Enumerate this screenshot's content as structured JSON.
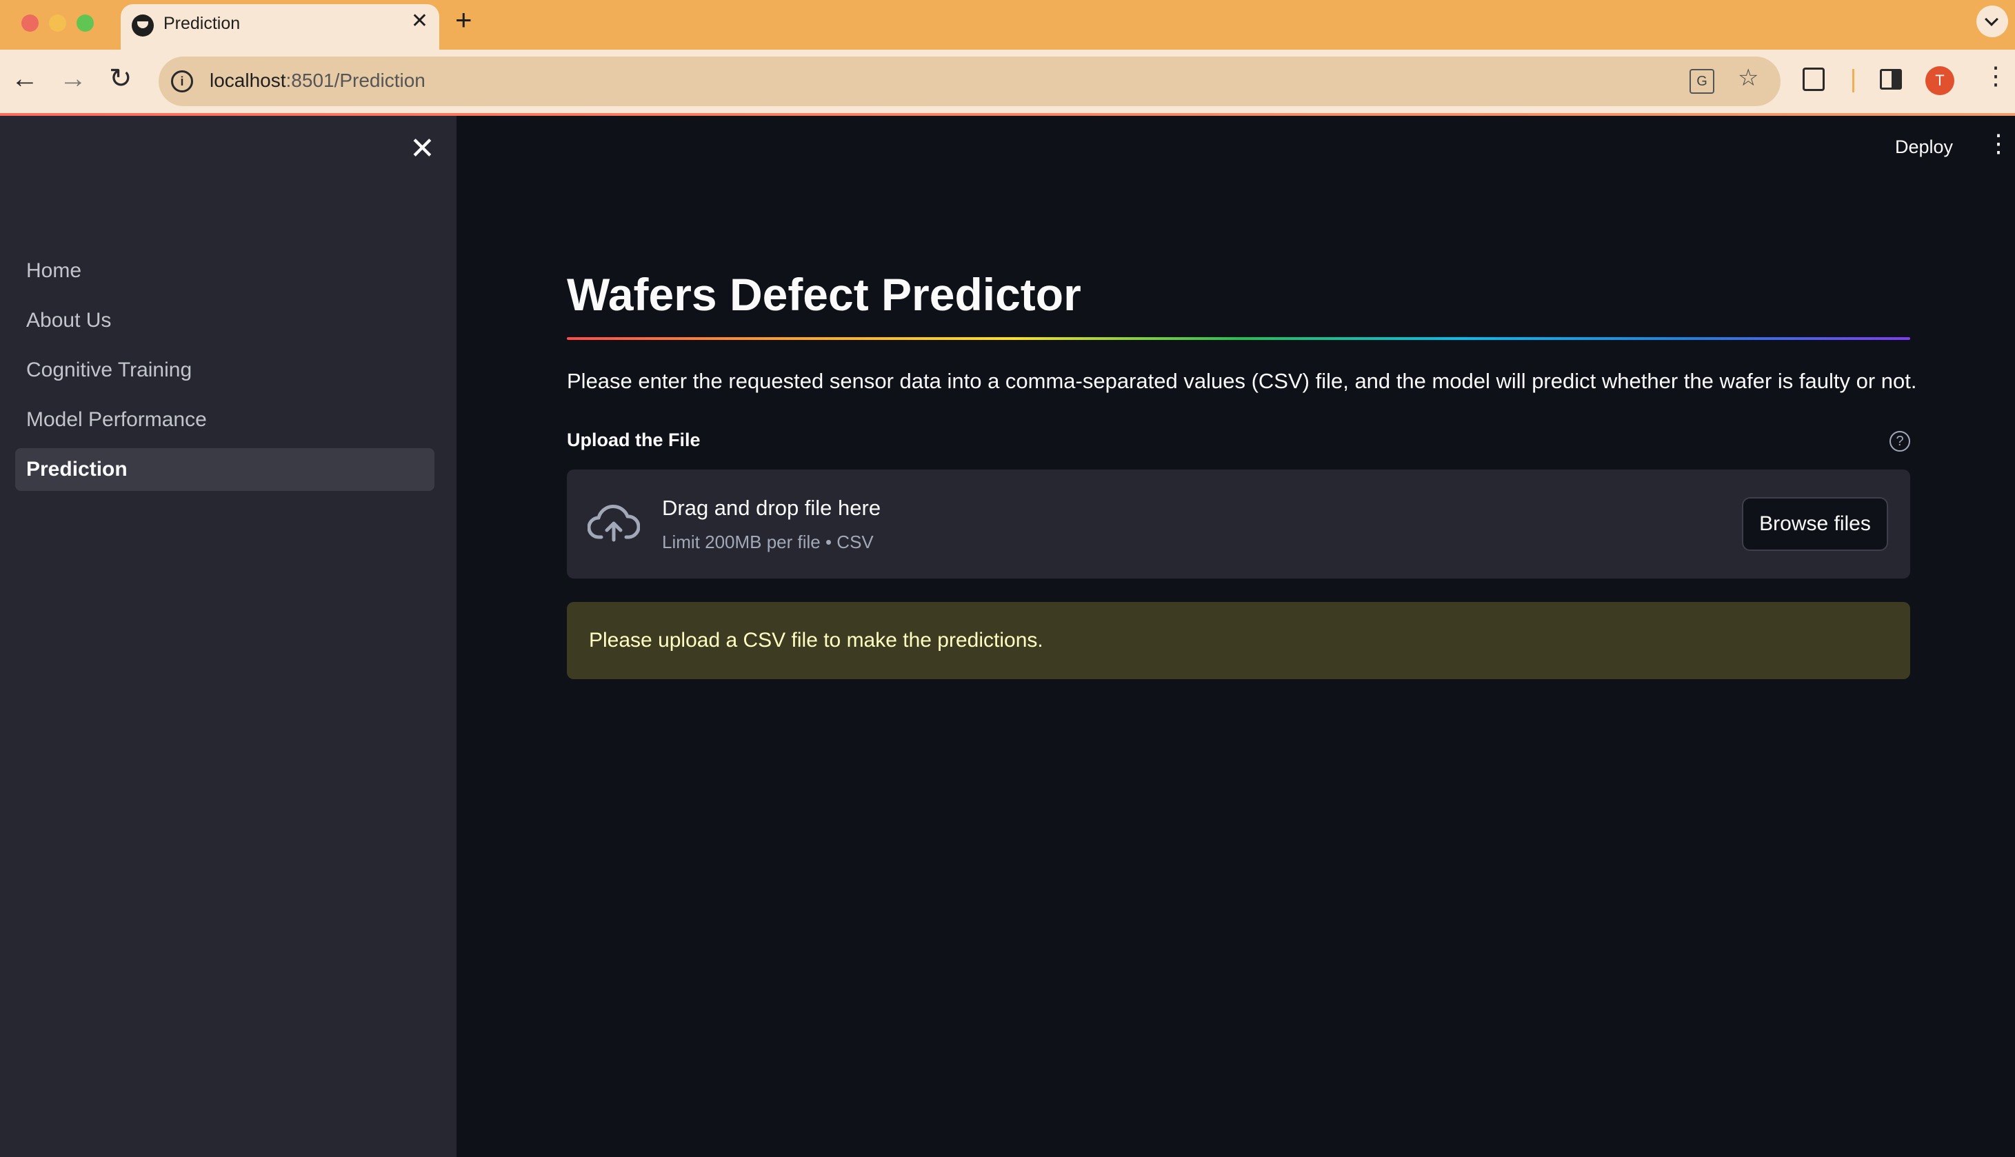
{
  "browser": {
    "tab_title": "Prediction",
    "tab_close": "✕",
    "new_tab": "+",
    "url_host": "localhost",
    "url_rest": ":8501/Prediction",
    "profile_initial": "T"
  },
  "sidebar": {
    "close": "✕",
    "items": [
      {
        "label": "Home"
      },
      {
        "label": "About Us"
      },
      {
        "label": "Cognitive Training"
      },
      {
        "label": "Model Performance"
      },
      {
        "label": "Prediction"
      }
    ],
    "active_index": 4
  },
  "header": {
    "deploy_label": "Deploy"
  },
  "main": {
    "title": "Wafers Defect Predictor",
    "intro": "Please enter the requested sensor data into a comma-separated values (CSV) file, and the model will predict whether the wafer is faulty or not.",
    "upload": {
      "label": "Upload the File",
      "dropzone_title": "Drag and drop file here",
      "dropzone_sub": "Limit 200MB per file • CSV",
      "browse_label": "Browse files"
    },
    "alert": "Please upload a CSV file to make the predictions."
  },
  "colors": {
    "sidebar_bg": "#262730",
    "main_bg": "#0e1117",
    "alert_bg": "#3e3b23",
    "alert_text": "#ffffc2",
    "chrome_accent": "#f2ae57"
  }
}
